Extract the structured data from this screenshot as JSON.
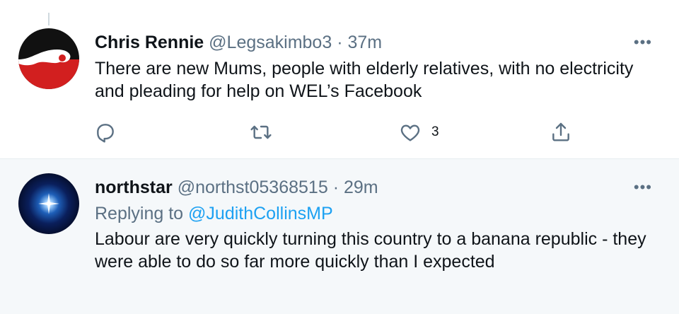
{
  "tweets": [
    {
      "display_name": "Chris Rennie",
      "handle": "@Legsakimbo3",
      "separator": "·",
      "time": "37m",
      "text": "There are new Mums, people with elderly relatives, with no electricity and pleading for help on WEL’s Facebook",
      "more_label": "•••",
      "actions": {
        "reply_count": "",
        "retweet_count": "",
        "like_count": "3",
        "share_count": ""
      },
      "icons": [
        "reply-icon",
        "retweet-icon",
        "like-icon",
        "share-icon"
      ]
    },
    {
      "display_name": "northstar",
      "handle": "@northst05368515",
      "separator": "·",
      "time": "29m",
      "replying_prefix": "Replying to",
      "replying_to": "@JudithCollinsMP",
      "text": "Labour are very quickly turning this country to a banana republic - they were able to do so far more quickly than I expected",
      "more_label": "•••"
    }
  ],
  "colors": {
    "link": "#1da1f2",
    "muted": "#5b7083",
    "text": "#0f1419",
    "reply_background": "#f5f8fa"
  }
}
